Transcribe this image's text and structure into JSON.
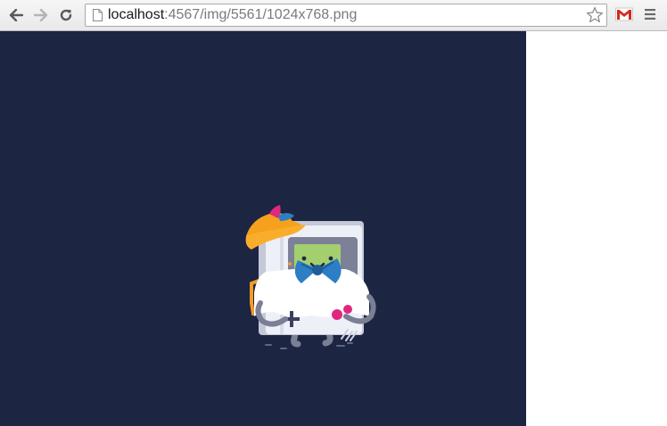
{
  "browser": {
    "back_icon": "arrow-left-icon",
    "forward_icon": "arrow-right-icon",
    "reload_icon": "reload-icon",
    "omnibox": {
      "host": "localhost",
      "path": ":4567/img/5561/1024x768.png",
      "page_icon": "page-icon",
      "star_icon": "star-icon"
    },
    "extension_icon": "gmail-icon",
    "menu_icon": "hamburger-menu-icon"
  },
  "content": {
    "background_color": "#1c2542",
    "image_subject": "gameboy-mascot-illustration"
  }
}
